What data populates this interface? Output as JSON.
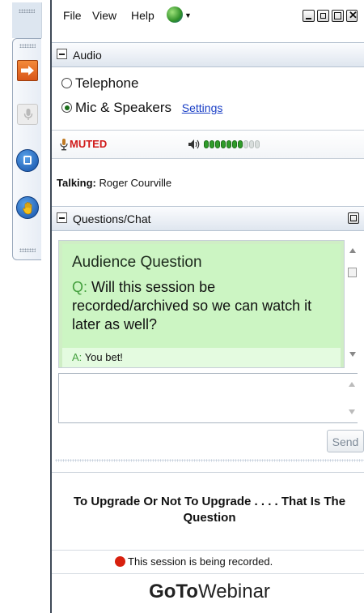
{
  "menubar": {
    "file": "File",
    "view": "View",
    "help": "Help"
  },
  "audio": {
    "header": "Audio",
    "options": [
      "Telephone",
      "Mic & Speakers"
    ],
    "selected": "Mic & Speakers",
    "settings_link": "Settings",
    "mic_state": "MUTED",
    "level_total": 10,
    "level_active": 7,
    "talking_label": "Talking:",
    "talking_name": "Roger Courville"
  },
  "chat": {
    "header": "Questions/Chat",
    "question_title": "Audience Question",
    "q_prefix": "Q:",
    "question": "Will this session be recorded/archived so we can watch it later as well?",
    "a_prefix": "A:",
    "answer": "You bet!",
    "send": "Send"
  },
  "webinar": {
    "title": "To Upgrade Or Not To Upgrade . . . . That Is The Question",
    "recording": "This session is being recorded."
  },
  "brand": {
    "bold": "GoTo",
    "light": "Webinar"
  },
  "colors": {
    "muted": "#d01a1a",
    "level_on": "#2f9b2a",
    "level_off": "#d9dedd",
    "chat_bg": "#ccf5c3",
    "link": "#1a3fc6",
    "recording_dot": "#d8200e"
  },
  "icons": [
    "orange-arrow-icon",
    "microphone-icon",
    "screen-icon",
    "raise-hand-icon",
    "globe-icon",
    "speaker-icon",
    "restore-icon"
  ]
}
